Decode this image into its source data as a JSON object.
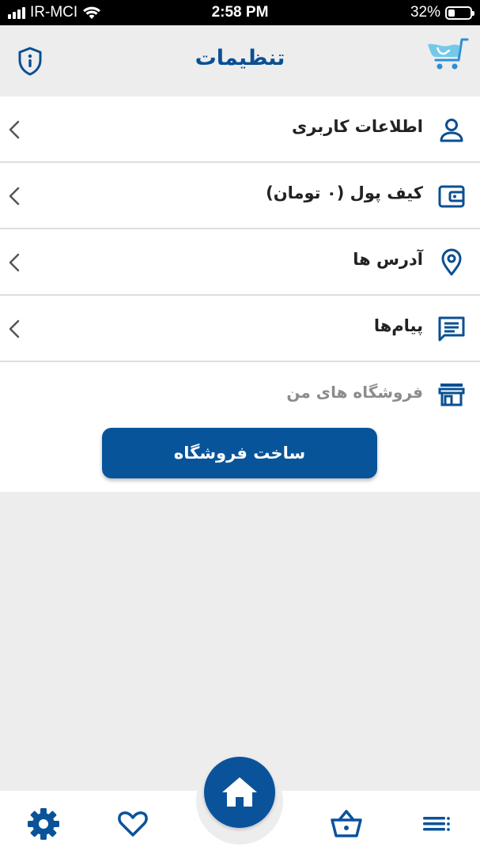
{
  "status_bar": {
    "carrier": "IR-MCI",
    "time": "2:58 PM",
    "battery_percent": "32%",
    "battery_level": 0.32
  },
  "header": {
    "title": "تنظیمات",
    "info_icon": "shield-info-icon",
    "logo_icon": "cart-logo-icon"
  },
  "settings": {
    "items": [
      {
        "label": "اطلاعات کاربری",
        "icon": "user-icon"
      },
      {
        "label": "کیف پول (۰ تومان)",
        "icon": "wallet-icon"
      },
      {
        "label": "آدرس ها",
        "icon": "location-pin-icon"
      },
      {
        "label": "پیام‌ها",
        "icon": "message-icon"
      }
    ],
    "stores_label": "فروشگاه های من",
    "stores_icon": "store-icon",
    "create_store_label": "ساخت فروشگاه"
  },
  "bottom_nav": {
    "items": [
      "gear-icon",
      "heart-icon",
      "home-icon",
      "basket-icon",
      "menu-icon"
    ]
  },
  "colors": {
    "primary": "#07549a",
    "title": "#0a4f92",
    "background": "#ededed"
  }
}
